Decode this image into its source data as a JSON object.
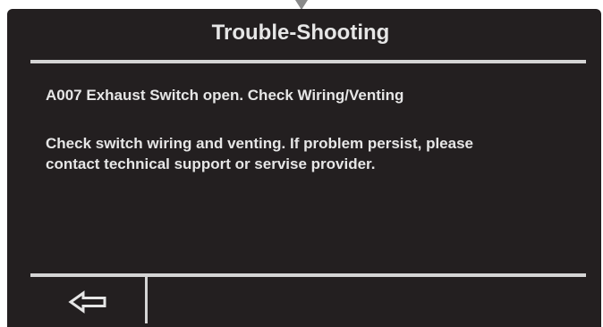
{
  "screen": {
    "title": "Trouble-Shooting",
    "error_line": "A007 Exhaust Switch open. Check Wiring/Venting",
    "message": "Check switch wiring and venting. If problem persist, please contact technical support or servise provider."
  },
  "footer": {
    "back_icon": "left-arrow-icon"
  },
  "colors": {
    "background": "#231f20",
    "text": "#e6e6e6",
    "rule": "#d4d4d4"
  }
}
